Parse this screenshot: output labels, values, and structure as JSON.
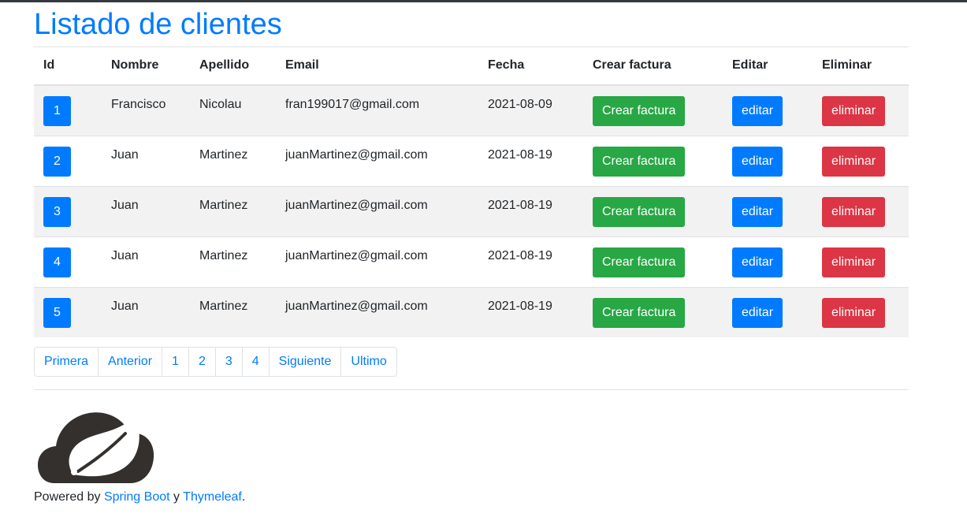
{
  "page_title": "Listado de clientes",
  "table": {
    "headers": {
      "id": "Id",
      "nombre": "Nombre",
      "apellido": "Apellido",
      "email": "Email",
      "fecha": "Fecha",
      "crear_factura": "Crear factura",
      "editar": "Editar",
      "eliminar": "Eliminar"
    },
    "rows": [
      {
        "id": "1",
        "nombre": "Francisco",
        "apellido": "Nicolau",
        "email": "fran199017@gmail.com",
        "fecha": "2021-08-09",
        "crear_factura": "Crear factura",
        "editar": "editar",
        "eliminar": "eliminar"
      },
      {
        "id": "2",
        "nombre": "Juan",
        "apellido": "Martinez",
        "email": "juanMartinez@gmail.com",
        "fecha": "2021-08-19",
        "crear_factura": "Crear factura",
        "editar": "editar",
        "eliminar": "eliminar"
      },
      {
        "id": "3",
        "nombre": "Juan",
        "apellido": "Martinez",
        "email": "juanMartinez@gmail.com",
        "fecha": "2021-08-19",
        "crear_factura": "Crear factura",
        "editar": "editar",
        "eliminar": "eliminar"
      },
      {
        "id": "4",
        "nombre": "Juan",
        "apellido": "Martinez",
        "email": "juanMartinez@gmail.com",
        "fecha": "2021-08-19",
        "crear_factura": "Crear factura",
        "editar": "editar",
        "eliminar": "eliminar"
      },
      {
        "id": "5",
        "nombre": "Juan",
        "apellido": "Martinez",
        "email": "juanMartinez@gmail.com",
        "fecha": "2021-08-19",
        "crear_factura": "Crear factura",
        "editar": "editar",
        "eliminar": "eliminar"
      }
    ]
  },
  "pagination": {
    "first": "Primera",
    "previous": "Anterior",
    "pages": [
      "1",
      "2",
      "3",
      "4"
    ],
    "next": "Siguiente",
    "last": "Ultimo"
  },
  "footer": {
    "logo_icon": "spring-leaf-icon",
    "powered_by": "Powered by",
    "spring_boot": "Spring Boot",
    "and": "y",
    "thymeleaf": "Thymeleaf",
    "period": "."
  },
  "colors": {
    "primary": "#007bff",
    "success": "#28a745",
    "danger": "#dc3545",
    "row_stripe": "#f2f2f2",
    "topbar": "#343a40"
  }
}
